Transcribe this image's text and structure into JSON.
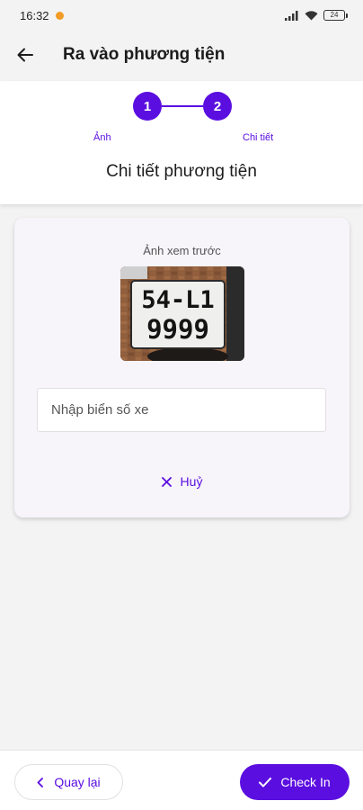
{
  "status_bar": {
    "time": "16:32",
    "battery": "24"
  },
  "app_bar": {
    "title": "Ra vào phương tiện"
  },
  "stepper": {
    "steps": [
      {
        "number": "1",
        "label": "Ảnh"
      },
      {
        "number": "2",
        "label": "Chi tiết"
      }
    ],
    "section_title": "Chi tiết phương tiện"
  },
  "card": {
    "preview_label": "Ảnh xem trước",
    "photo": {
      "plate_line1": "54-L1",
      "plate_line2": "9999"
    },
    "plate_input": {
      "placeholder": "Nhập biển số xe",
      "value": ""
    },
    "cancel_label": "Huỷ"
  },
  "footer": {
    "back_label": "Quay lại",
    "checkin_label": "Check In"
  },
  "colors": {
    "accent": "#5b0ee0",
    "background": "#f3f3f3",
    "card": "#f7f4fa"
  }
}
